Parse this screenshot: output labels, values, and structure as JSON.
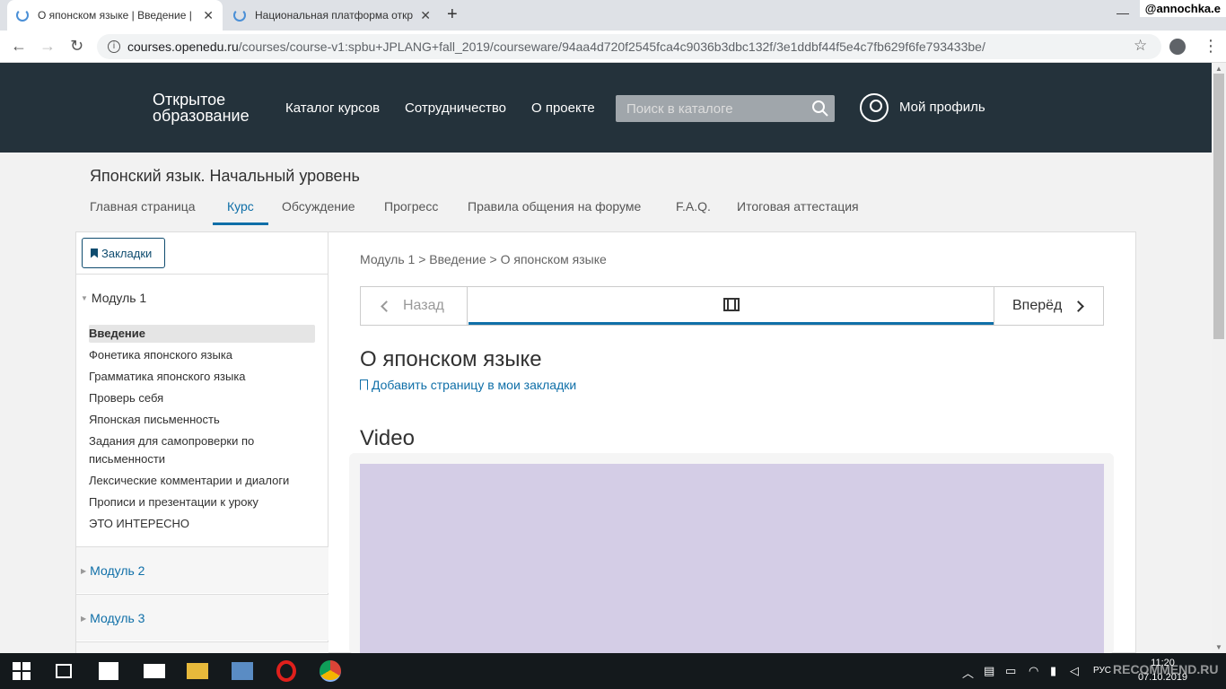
{
  "browser": {
    "tabs": [
      {
        "title": "О японском языке | Введение |"
      },
      {
        "title": "Национальная платформа откр"
      }
    ],
    "url_host": "courses.openedu.ru",
    "url_path": "/courses/course-v1:spbu+JPLANG+fall_2019/courseware/94aa4d720f2545fca4c9036b3dbc132f/3e1ddbf44f5e4c7fb629f6fe793433be/",
    "user_overlay": "@annochka.e"
  },
  "site": {
    "logo_line1": "Открытое",
    "logo_line2": "образование",
    "nav": [
      "Каталог курсов",
      "Сотрудничество",
      "О проекте"
    ],
    "search_placeholder": "Поиск в каталоге",
    "profile_label": "Мой профиль"
  },
  "course": {
    "title": "Японский язык. Начальный уровень",
    "tabs": [
      "Главная страница",
      "Курс",
      "Обсуждение",
      "Прогресс",
      "Правила общения на форуме",
      "F.A.Q.",
      "Итоговая аттестация"
    ],
    "active_tab": "Курс"
  },
  "sidebar": {
    "bookmarks_label": "Закладки",
    "module1": "Модуль 1",
    "subsections": [
      "Введение",
      "Фонетика японского языка",
      "Грамматика японского языка",
      "Проверь себя",
      "Японская письменность",
      "Задания для самопроверки по письменности",
      "Лексические комментарии и диалоги",
      "Прописи и презентации к уроку",
      "ЭТО ИНТЕРЕСНО"
    ],
    "module2": "Модуль 2",
    "module3": "Модуль 3"
  },
  "main": {
    "breadcrumb": "Модуль 1 > Введение > О японском языке",
    "prev_label": "Назад",
    "next_label": "Вперёд",
    "unit_title": "О японском языке",
    "add_bookmark": "Добавить страницу в мои закладки",
    "video_heading": "Video"
  },
  "taskbar": {
    "lang": "РУС",
    "time": "11:20",
    "date": "07.10.2019",
    "watermark": "RECOMMEND.RU"
  },
  "colors": {
    "header_bg": "#24323b",
    "accent": "#0f6fa8",
    "video_placeholder": "#d4cde6"
  }
}
